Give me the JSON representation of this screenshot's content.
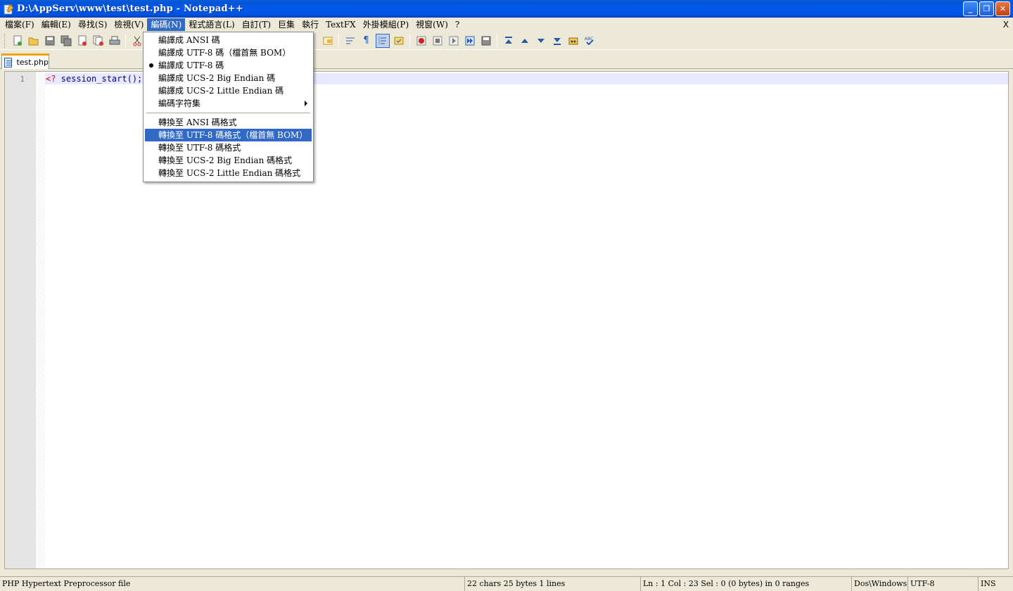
{
  "window": {
    "title": "D:\\AppServ\\www\\test\\test.php - Notepad++",
    "minimize_label": "_",
    "restore_label": "❐",
    "close_label": "✕"
  },
  "menubar": {
    "items": [
      "檔案(F)",
      "編輯(E)",
      "尋找(S)",
      "檢視(V)",
      "編碼(N)",
      "程式語言(L)",
      "自訂(T)",
      "巨集",
      "執行",
      "TextFX",
      "外掛模組(P)",
      "視窗(W)",
      "?"
    ],
    "active_index": 4,
    "close_label": "X"
  },
  "encoding_menu": {
    "items": [
      {
        "label": "編譯成 ANSI 碼",
        "checked": false
      },
      {
        "label": "編譯成 UTF-8 碼（檔首無 BOM）",
        "checked": false
      },
      {
        "label": "編譯成 UTF-8 碼",
        "checked": true
      },
      {
        "label": "編譯成 UCS-2 Big Endian 碼",
        "checked": false
      },
      {
        "label": "編譯成 UCS-2 Little Endian 碼",
        "checked": false
      },
      {
        "label": "編碼字符集",
        "submenu": true
      }
    ],
    "convert_items": [
      {
        "label": "轉換至 ANSI 碼格式"
      },
      {
        "label": "轉換至 UTF-8 碼格式（檔首無 BOM）",
        "highlighted": true
      },
      {
        "label": "轉換至 UTF-8 碼格式"
      },
      {
        "label": "轉換至 UCS-2 Big Endian 碼格式"
      },
      {
        "label": "轉換至 UCS-2 Little Endian 碼格式"
      }
    ]
  },
  "tabs": [
    {
      "label": "test.php",
      "active": true
    }
  ],
  "editor": {
    "line_number": "1",
    "code_tag": "<?",
    "code_rest": " session_start();"
  },
  "statusbar": {
    "file_type": "PHP Hypertext Preprocessor file",
    "counts": "22 chars   25 bytes   1 lines",
    "position": "Ln : 1    Col : 23    Sel : 0 (0 bytes) in 0 ranges",
    "eol": "Dos\\Windows",
    "encoding": "UTF-8",
    "mode": "INS"
  },
  "colors": {
    "titlebar": "#0058ee",
    "menu_highlight": "#316ac5",
    "caret_line": "#e8e8ff",
    "php_tag": "#ff0000"
  }
}
